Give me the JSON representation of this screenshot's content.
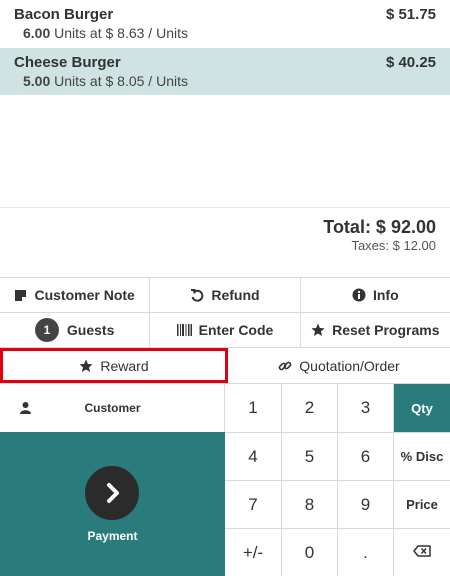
{
  "orderlines": [
    {
      "name": "Bacon Burger",
      "price": "$ 51.75",
      "qty": "6.00",
      "unit_text": " Units at $ 8.63 / Units",
      "selected": false
    },
    {
      "name": "Cheese Burger",
      "price": "$ 40.25",
      "qty": "5.00",
      "unit_text": " Units at $ 8.05 / Units",
      "selected": true
    }
  ],
  "summary": {
    "total": "Total: $ 92.00",
    "taxes": "Taxes: $ 12.00"
  },
  "controls": {
    "customer_note": "Customer Note",
    "refund": "Refund",
    "info": "Info",
    "guests_count": "1",
    "guests": "Guests",
    "enter_code": "Enter Code",
    "reset_programs": "Reset Programs",
    "reward": "Reward",
    "quotation_order": "Quotation/Order"
  },
  "customer_label": "Customer",
  "payment_label": "Payment",
  "numpad": {
    "k1": "1",
    "k2": "2",
    "k3": "3",
    "qty": "Qty",
    "k4": "4",
    "k5": "5",
    "k6": "6",
    "disc": "% Disc",
    "k7": "7",
    "k8": "8",
    "k9": "9",
    "price": "Price",
    "plusminus": "+/-",
    "k0": "0",
    "dot": "."
  },
  "colors": {
    "accent": "#2a7b7b",
    "selected_line": "#cfe3e3",
    "highlight_border": "#e0000f"
  },
  "icons": [
    "note-icon",
    "refund-icon",
    "info-icon",
    "barcode-icon",
    "star-icon",
    "link-icon",
    "user-icon",
    "chevron-right-icon",
    "backspace-icon"
  ]
}
